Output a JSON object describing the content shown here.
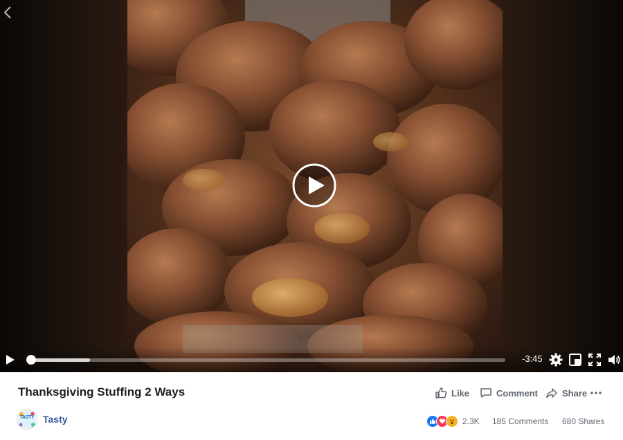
{
  "video": {
    "time_remaining": "-3:45",
    "progress_fraction": 0.0,
    "buffered_fraction": 0.13
  },
  "post": {
    "title": "Thanksgiving Stuffing 2 Ways",
    "page_name": "Tasty",
    "avatar_text": "TASTY"
  },
  "actions": {
    "like_label": "Like",
    "comment_label": "Comment",
    "share_label": "Share"
  },
  "stats": {
    "reactions": [
      "like",
      "love",
      "wow"
    ],
    "reactions_count": "2.3K",
    "comments": "185 Comments",
    "shares": "680 Shares"
  },
  "colors": {
    "link": "#385898",
    "muted": "#606770",
    "title": "#1c1e21",
    "like_blue": "#1877f2",
    "love_red": "#f33e58",
    "wow_yellow": "#f7b125"
  }
}
